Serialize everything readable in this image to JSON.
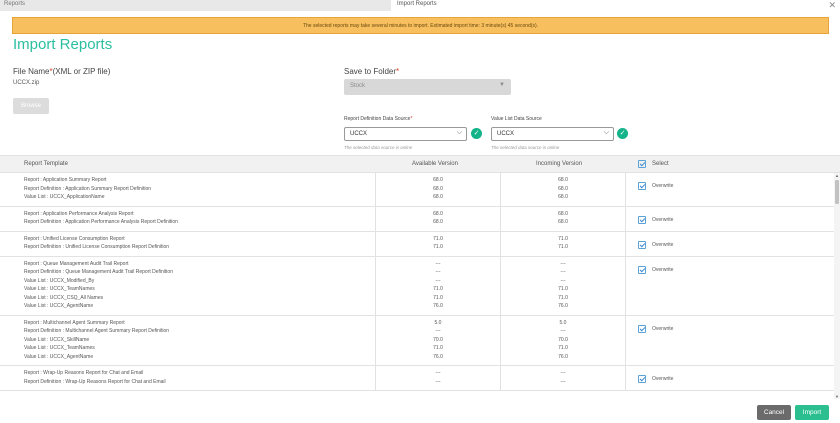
{
  "tabs": {
    "background_tab": "Reports",
    "active_tab": "Import Reports"
  },
  "banner": {
    "text": "The selected reports may take several minutes to import. Estimated import time: 3 minute(s) 45 second(s)."
  },
  "title": "Import Reports",
  "file_name": {
    "label": "File Name",
    "required_mark": "*",
    "label_suffix": "(XML or ZIP file)",
    "value": "UCCX.zip",
    "browse_label": "Browse"
  },
  "save_to_folder": {
    "label": "Save to Folder",
    "required_mark": "*",
    "value": "Stock"
  },
  "report_definition_ds": {
    "label": "Report Definition Data Source",
    "required_mark": "*",
    "value": "UCCX",
    "hint": "The selected data source is online"
  },
  "value_list_ds": {
    "label": "Value List Data Source",
    "value": "UCCX",
    "hint": "The selected data source is online"
  },
  "table": {
    "headers": {
      "template": "Report Template",
      "available": "Available Version",
      "incoming": "Incoming Version",
      "select": "Select"
    },
    "overwrite_label": "Overwrite",
    "groups": [
      {
        "lines": [
          {
            "name": "Report : Application Summary Report",
            "available": "68.0",
            "incoming": "68.0"
          },
          {
            "name": "Report Definition : Application Summary Report Definition",
            "available": "68.0",
            "incoming": "68.0"
          },
          {
            "name": "Value List : UCCX_ApplicationName",
            "available": "68.0",
            "incoming": "68.0"
          }
        ]
      },
      {
        "lines": [
          {
            "name": "Report : Application Performance Analysis Report",
            "available": "68.0",
            "incoming": "68.0"
          },
          {
            "name": "Report Definition : Application Performance Analysis Report Definition",
            "available": "68.0",
            "incoming": "68.0"
          }
        ]
      },
      {
        "lines": [
          {
            "name": "Report : Unified License Consumption Report",
            "available": "71.0",
            "incoming": "71.0"
          },
          {
            "name": "Report Definition : Unified License Consumption Report Definition",
            "available": "71.0",
            "incoming": "71.0"
          }
        ]
      },
      {
        "lines": [
          {
            "name": "Report : Queue Management Audit Trail Report",
            "available": "---",
            "incoming": "---"
          },
          {
            "name": "Report Definition : Queue Management Audit Trail Report Definition",
            "available": "---",
            "incoming": "---"
          },
          {
            "name": "Value List : UCCX_Modified_By",
            "available": "---",
            "incoming": "---"
          },
          {
            "name": "Value List : UCCX_TeamNames",
            "available": "71.0",
            "incoming": "71.0"
          },
          {
            "name": "Value List : UCCX_CSQ_All Names",
            "available": "71.0",
            "incoming": "71.0"
          },
          {
            "name": "Value List : UCCX_AgentName",
            "available": "76.0",
            "incoming": "76.0"
          }
        ]
      },
      {
        "lines": [
          {
            "name": "Report : Multichannel Agent Summary Report",
            "available": "5.0",
            "incoming": "5.0"
          },
          {
            "name": "Report Definition : Multichannel Agent Summary Report Definition",
            "available": "---",
            "incoming": "---"
          },
          {
            "name": "Value List : UCCX_SkillName",
            "available": "70.0",
            "incoming": "70.0"
          },
          {
            "name": "Value List : UCCX_TeamNames",
            "available": "71.0",
            "incoming": "71.0"
          },
          {
            "name": "Value List : UCCX_AgentName",
            "available": "76.0",
            "incoming": "76.0"
          }
        ]
      },
      {
        "lines": [
          {
            "name": "Report : Wrap-Up Reasons Report for Chat and Email",
            "available": "---",
            "incoming": "---"
          },
          {
            "name": "Report Definition : Wrap-Up Reasons Report for Chat and Email",
            "available": "---",
            "incoming": "---"
          }
        ]
      }
    ]
  },
  "buttons": {
    "cancel": "Cancel",
    "import": "Import"
  },
  "colors": {
    "accent": "#2bbf9f",
    "banner": "#f7bf5e",
    "ok": "#15b38a"
  }
}
